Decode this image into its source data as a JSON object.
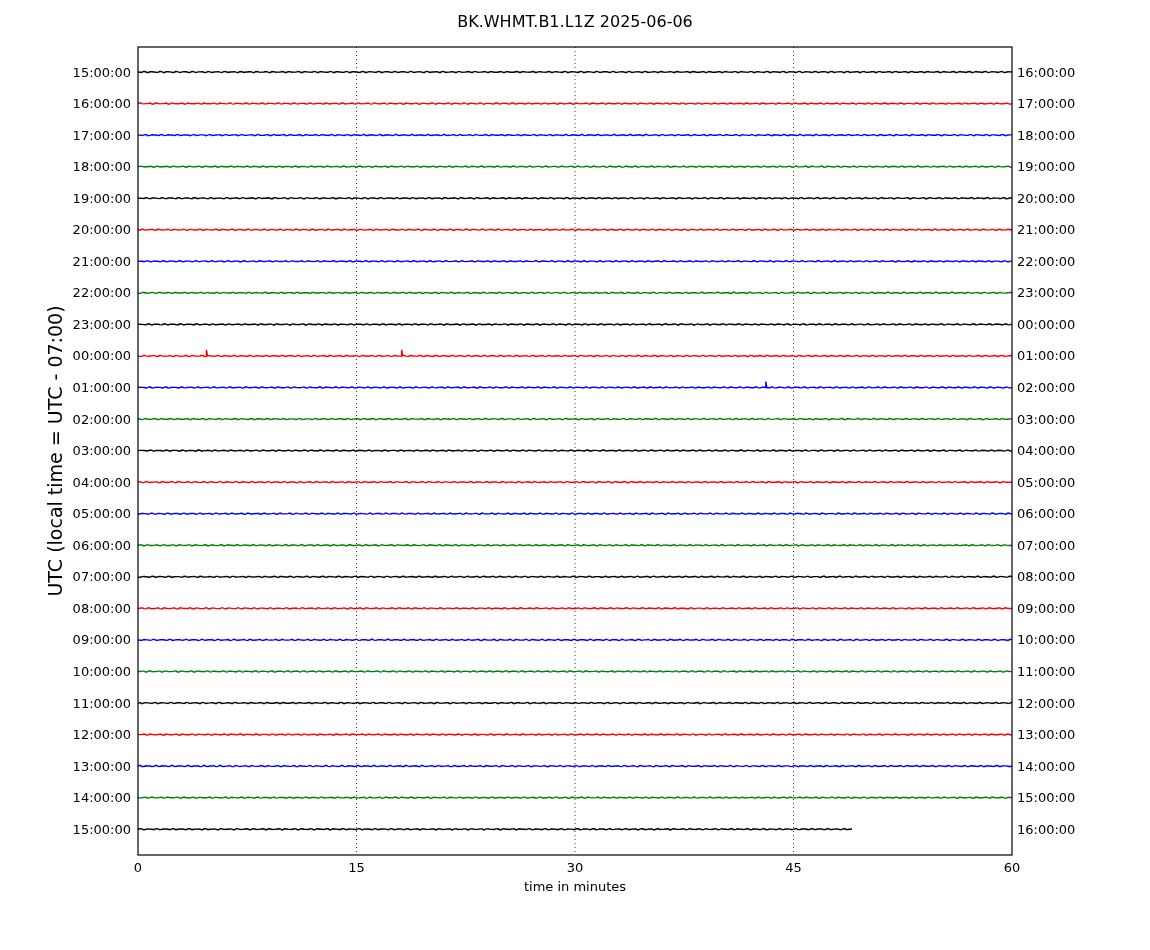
{
  "title": "BK.WHMT.B1.L1Z 2025-06-06",
  "ylabel": "UTC (local time = UTC - 07:00)",
  "xlabel": "time in minutes",
  "xticks": [
    "0",
    "15",
    "30",
    "45",
    "60"
  ],
  "traces": [
    {
      "left": "15:00:00",
      "right": "16:00:00",
      "color": "#000000",
      "level": 1
    },
    {
      "left": "16:00:00",
      "right": "17:00:00",
      "color": "#ff0000",
      "level": 1
    },
    {
      "left": "17:00:00",
      "right": "18:00:00",
      "color": "#0000ff",
      "level": 1
    },
    {
      "left": "18:00:00",
      "right": "19:00:00",
      "color": "#008000",
      "level": 1
    },
    {
      "left": "19:00:00",
      "right": "20:00:00",
      "color": "#000000",
      "level": 1
    },
    {
      "left": "20:00:00",
      "right": "21:00:00",
      "color": "#ff0000",
      "level": 1
    },
    {
      "left": "21:00:00",
      "right": "22:00:00",
      "color": "#0000ff",
      "level": 1
    },
    {
      "left": "22:00:00",
      "right": "23:00:00",
      "color": "#008000",
      "level": 1
    },
    {
      "left": "23:00:00",
      "right": "00:00:00",
      "color": "#000000",
      "level": 1
    },
    {
      "left": "00:00:00",
      "right": "01:00:00",
      "color": "#ff0000",
      "level": 1
    },
    {
      "left": "01:00:00",
      "right": "02:00:00",
      "color": "#0000ff",
      "level": 1
    },
    {
      "left": "02:00:00",
      "right": "03:00:00",
      "color": "#008000",
      "level": 1
    },
    {
      "left": "03:00:00",
      "right": "04:00:00",
      "color": "#000000",
      "level": 1
    },
    {
      "left": "04:00:00",
      "right": "05:00:00",
      "color": "#ff0000",
      "level": 1
    },
    {
      "left": "05:00:00",
      "right": "06:00:00",
      "color": "#0000ff",
      "level": 1
    },
    {
      "left": "06:00:00",
      "right": "07:00:00",
      "color": "#008000",
      "level": 1
    },
    {
      "left": "07:00:00",
      "right": "08:00:00",
      "color": "#000000",
      "level": 1
    },
    {
      "left": "08:00:00",
      "right": "09:00:00",
      "color": "#ff0000",
      "level": 1
    },
    {
      "left": "09:00:00",
      "right": "10:00:00",
      "color": "#0000ff",
      "level": 1
    },
    {
      "left": "10:00:00",
      "right": "11:00:00",
      "color": "#008000",
      "level": 1
    },
    {
      "left": "11:00:00",
      "right": "12:00:00",
      "color": "#000000",
      "level": 1
    },
    {
      "left": "12:00:00",
      "right": "13:00:00",
      "color": "#ff0000",
      "level": 1
    },
    {
      "left": "13:00:00",
      "right": "14:00:00",
      "color": "#0000ff",
      "level": 1
    },
    {
      "left": "14:00:00",
      "right": "15:00:00",
      "color": "#008000",
      "level": 1
    },
    {
      "left": "15:00:00",
      "right": "16:00:00",
      "color": "#000000",
      "level": 0.818
    }
  ]
}
